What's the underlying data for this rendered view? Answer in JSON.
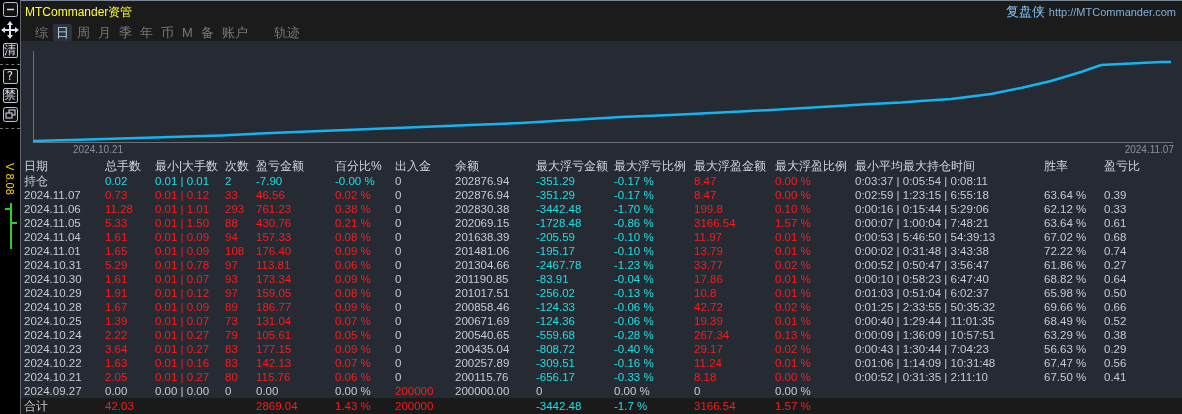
{
  "toolbar": {
    "buttons": [
      {
        "kind": "icon"
      },
      {
        "kind": "icon"
      },
      {
        "kind": "text",
        "label": "清"
      },
      {
        "kind": "text",
        "label": "?"
      },
      {
        "kind": "text",
        "label": "禁"
      },
      {
        "kind": "icon"
      }
    ],
    "version": "V 8.08"
  },
  "header": {
    "title": "MTCommander资管",
    "brand": "复盘侠",
    "link": "http://MTCommander.com"
  },
  "tabs": [
    {
      "label": "综",
      "selected": false
    },
    {
      "label": "日",
      "selected": true
    },
    {
      "label": "周",
      "selected": false
    },
    {
      "label": "月",
      "selected": false
    },
    {
      "label": "季",
      "selected": false
    },
    {
      "label": "年",
      "selected": false
    },
    {
      "label": "币",
      "selected": false
    },
    {
      "label": "M",
      "selected": false
    },
    {
      "label": "备",
      "selected": false
    },
    {
      "label": "账户",
      "selected": false
    },
    {
      "label": "轨迹",
      "selected": false
    }
  ],
  "chart": {
    "start_label": "2024.10.21",
    "end_label": "2024.11.07"
  },
  "table": {
    "columns": [
      "日期",
      "总手数",
      "最小|大手数",
      "次数",
      "盈亏金额",
      "百分比%",
      "出入金",
      "余额",
      "最大浮亏金额",
      "最大浮亏比例",
      "最大浮盈金额",
      "最大浮盈比例",
      "最小平均最大持仓时间",
      "胜率",
      "盈亏比"
    ],
    "rows": [
      {
        "kind": "open",
        "cells": [
          "持仓",
          "0.02",
          "0.01 | 0.01",
          "2",
          "-7.90",
          "-0.00 %",
          "0",
          "202876.94",
          "-351.29",
          "-0.17 %",
          "8.47",
          "0.00 %",
          "0:03:37 | 0:05:54 | 0:08:11",
          null,
          null
        ]
      },
      {
        "kind": "day",
        "cells": [
          "2024.11.07",
          "0.73",
          "0.01 | 0.12",
          "33",
          "46.56",
          "0.02 %",
          "0",
          "202876.94",
          "-351.29",
          "-0.17 %",
          "8.47",
          "0.00 %",
          "0:02:59 | 1:23:15 | 6:55:18",
          "63.64 %",
          "0.39"
        ]
      },
      {
        "kind": "day",
        "cells": [
          "2024.11.06",
          "11.28",
          "0.01 | 1.01",
          "293",
          "761.23",
          "0.38 %",
          "0",
          "202830.38",
          "-3442.48",
          "-1.70 %",
          "199.8",
          "0.10 %",
          "0:00:16 | 0:15:44 | 5:29:06",
          "62.12 %",
          "0.33"
        ]
      },
      {
        "kind": "day",
        "cells": [
          "2024.11.05",
          "5.33",
          "0.01 | 1.50",
          "88",
          "430.76",
          "0.21 %",
          "0",
          "202069.15",
          "-1728.48",
          "-0.86 %",
          "3166.54",
          "1.57 %",
          "0:00:07 | 1:00:04 | 7:48:21",
          "63.64 %",
          "0.61"
        ]
      },
      {
        "kind": "day",
        "cells": [
          "2024.11.04",
          "1.61",
          "0.01 | 0.09",
          "94",
          "157.33",
          "0.08 %",
          "0",
          "201638.39",
          "-205.59",
          "-0.10 %",
          "11.97",
          "0.01 %",
          "0:00:53 | 5:46:50 | 54:39:13",
          "67.02 %",
          "0.68"
        ]
      },
      {
        "kind": "day",
        "cells": [
          "2024.11.01",
          "1.65",
          "0.01 | 0.09",
          "108",
          "176.40",
          "0.09 %",
          "0",
          "201481.06",
          "-195.17",
          "-0.10 %",
          "13.79",
          "0.01 %",
          "0:00:02 | 0:31:48 | 3:43:38",
          "72.22 %",
          "0.74"
        ]
      },
      {
        "kind": "day",
        "cells": [
          "2024.10.31",
          "5.29",
          "0.01 | 0.78",
          "97",
          "113.81",
          "0.06 %",
          "0",
          "201304.66",
          "-2467.78",
          "-1.23 %",
          "33.77",
          "0.02 %",
          "0:00:52 | 0:50:47 | 3:56:47",
          "61.86 %",
          "0.27"
        ]
      },
      {
        "kind": "day",
        "cells": [
          "2024.10.30",
          "1.61",
          "0.01 | 0.07",
          "93",
          "173.34",
          "0.09 %",
          "0",
          "201190.85",
          "-83.91",
          "-0.04 %",
          "17.86",
          "0.01 %",
          "0:00:10 | 0:58:23 | 6:47:40",
          "68.82 %",
          "0.64"
        ]
      },
      {
        "kind": "day",
        "cells": [
          "2024.10.29",
          "1.91",
          "0.01 | 0.12",
          "97",
          "159.05",
          "0.08 %",
          "0",
          "201017.51",
          "-256.02",
          "-0.13 %",
          "10.8",
          "0.01 %",
          "0:01:03 | 0:51:04 | 6:02:37",
          "65.98 %",
          "0.50"
        ]
      },
      {
        "kind": "day",
        "cells": [
          "2024.10.28",
          "1.67",
          "0.01 | 0.09",
          "89",
          "186.77",
          "0.09 %",
          "0",
          "200858.46",
          "-124.33",
          "-0.06 %",
          "42.72",
          "0.02 %",
          "0:01:25 | 2:33:55 | 50:35:32",
          "69.66 %",
          "0.66"
        ]
      },
      {
        "kind": "day",
        "cells": [
          "2024.10.25",
          "1.39",
          "0.01 | 0.07",
          "73",
          "131.04",
          "0.07 %",
          "0",
          "200671.69",
          "-124.36",
          "-0.06 %",
          "19.39",
          "0.01 %",
          "0:00:40 | 1:29:44 | 11:01:35",
          "68.49 %",
          "0.52"
        ]
      },
      {
        "kind": "day",
        "cells": [
          "2024.10.24",
          "2.22",
          "0.01 | 0.27",
          "79",
          "105.61",
          "0.05 %",
          "0",
          "200540.65",
          "-559.68",
          "-0.28 %",
          "267.34",
          "0.13 %",
          "0:00:09 | 1:36:09 | 10:57:51",
          "63.29 %",
          "0.38"
        ]
      },
      {
        "kind": "day",
        "cells": [
          "2024.10.23",
          "3.64",
          "0.01 | 0.27",
          "83",
          "177.15",
          "0.09 %",
          "0",
          "200435.04",
          "-808.72",
          "-0.40 %",
          "29.17",
          "0.02 %",
          "0:00:43 | 1:30:44 | 7:04:23",
          "56.63 %",
          "0.29"
        ]
      },
      {
        "kind": "day",
        "cells": [
          "2024.10.22",
          "1.63",
          "0.01 | 0.16",
          "83",
          "142.13",
          "0.07 %",
          "0",
          "200257.89",
          "-309.51",
          "-0.16 %",
          "11.24",
          "0.01 %",
          "0:01:06 | 1:14:09 | 10:31:48",
          "67.47 %",
          "0.56"
        ]
      },
      {
        "kind": "day",
        "cells": [
          "2024.10.21",
          "2.05",
          "0.01 | 0.27",
          "80",
          "115.76",
          "0.06 %",
          "0",
          "200115.76",
          "-656.17",
          "-0.33 %",
          "8.18",
          "0.00 %",
          "0:00:52 | 0:31:35 | 2:11:10",
          "67.50 %",
          "0.41"
        ]
      },
      {
        "kind": "deposit",
        "cells": [
          "2024.09.27",
          "0.00",
          "0.00 | 0.00",
          "0",
          "0.00",
          "0.00 %",
          "200000",
          "200000.00",
          "0",
          "0.00 %",
          "0",
          "0.00 %",
          null,
          null,
          null
        ]
      },
      {
        "kind": "total",
        "cells": [
          "合计",
          "42.03",
          null,
          null,
          "2869.04",
          "1.43 %",
          "200000",
          null,
          "-3442.48",
          "-1.7 %",
          "3166.54",
          "1.57 %",
          null,
          null,
          null
        ]
      }
    ]
  }
}
